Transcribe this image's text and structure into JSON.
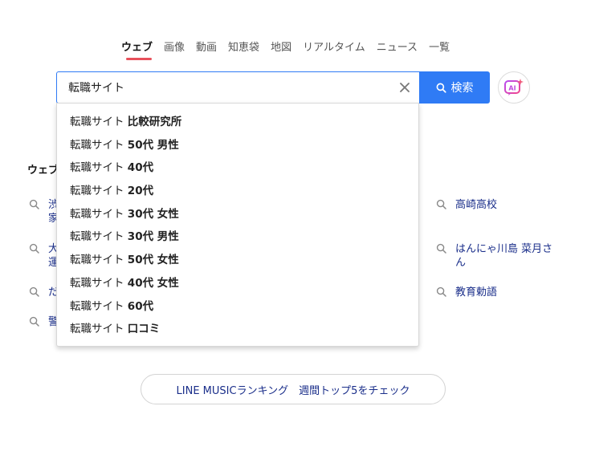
{
  "tabs": [
    {
      "label": "ウェブ",
      "active": true
    },
    {
      "label": "画像"
    },
    {
      "label": "動画"
    },
    {
      "label": "知恵袋"
    },
    {
      "label": "地図"
    },
    {
      "label": "リアルタイム"
    },
    {
      "label": "ニュース"
    },
    {
      "label": "一覧"
    }
  ],
  "search": {
    "value": "転職サイト",
    "button_label": "検索"
  },
  "ai_button": {
    "icon": "ai-sparkle-icon",
    "label": "AI"
  },
  "suggestions": [
    {
      "prefix": "転職サイト",
      "suffix": "比較研究所"
    },
    {
      "prefix": "転職サイト",
      "suffix": "50代 男性"
    },
    {
      "prefix": "転職サイト",
      "suffix": "40代"
    },
    {
      "prefix": "転職サイト",
      "suffix": "20代"
    },
    {
      "prefix": "転職サイト",
      "suffix": "30代 女性"
    },
    {
      "prefix": "転職サイト",
      "suffix": "30代 男性"
    },
    {
      "prefix": "転職サイト",
      "suffix": "50代 女性"
    },
    {
      "prefix": "転職サイト",
      "suffix": "40代 女性"
    },
    {
      "prefix": "転職サイト",
      "suffix": "60代"
    },
    {
      "prefix": "転職サイト",
      "suffix": "口コミ"
    }
  ],
  "trends": {
    "section_label": "ウェブ",
    "left_partial": [
      "渋",
      "家",
      "大",
      "運",
      "だ",
      "警"
    ],
    "right": [
      "高崎高校",
      "はんにゃ川島 菜月さん",
      "教育勅語"
    ]
  },
  "promo": {
    "label": "LINE MUSICランキング　週間トップ5をチェック"
  },
  "colors": {
    "accent": "#2f7bf5",
    "active_tab_underline": "#e8505b",
    "link": "#1a2e8a"
  }
}
